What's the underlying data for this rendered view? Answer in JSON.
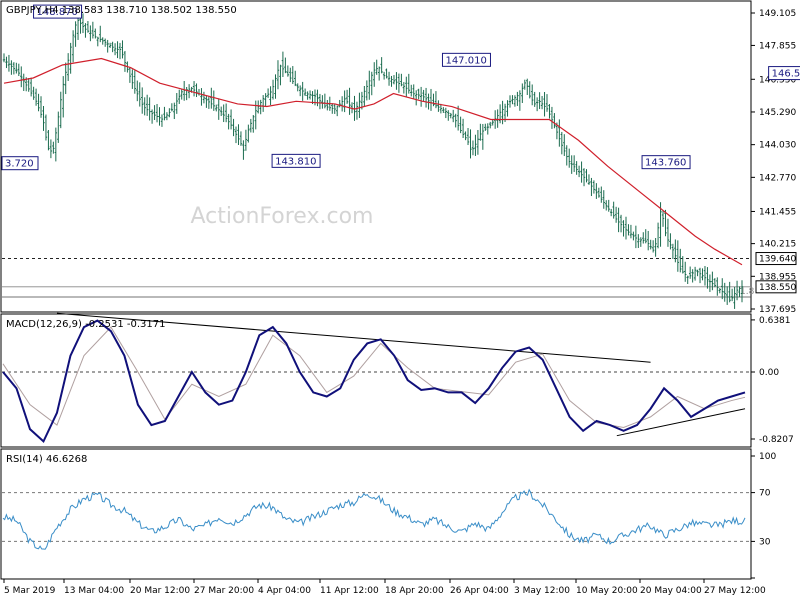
{
  "watermark": "ActionForex.com",
  "price_pane": {
    "header": "GBPJPY,H4  138.583 138.710 138.502 138.550",
    "y_ticks": [
      "149.105",
      "147.855",
      "146.550",
      "145.290",
      "144.030",
      "142.770",
      "141.455",
      "140.215",
      "138.955",
      "137.695"
    ],
    "current_price_label": "138.550",
    "level_line_label": "139.640",
    "cut_label": "1.8"
  },
  "macd_pane": {
    "header": "MACD(12,26,9) -0.2531 -0.3171",
    "y_ticks": [
      "0.6381",
      "0.00",
      "-0.8207"
    ]
  },
  "rsi_pane": {
    "header": "RSI(14) 46.6268",
    "y_ticks": [
      "100",
      "70",
      "30",
      "0"
    ]
  },
  "x_ticks": [
    "5 Mar 2019",
    "13 Mar 04:00",
    "20 Mar 12:00",
    "27 Mar 20:00",
    "4 Apr 04:00",
    "11 Apr 12:00",
    "18 Apr 20:00",
    "26 Apr 04:00",
    "3 May 12:00",
    "10 May 20:00",
    "20 May 04:00",
    "27 May 12:00"
  ],
  "colors": {
    "candle": "#1a6b4e",
    "ma": "#d0202c",
    "macd": "#10107a",
    "signal": "#b0a0a0",
    "rsi": "#3a8ec8",
    "label_border": "#1a1a80"
  },
  "chart_data": [
    {
      "type": "candlestick",
      "title": "GBPJPY,H4",
      "ylim": [
        137.4,
        149.4
      ],
      "swing_labels": [
        {
          "text": "148.870",
          "x": 5.5,
          "value": 148.87
        },
        {
          "text": "3.720",
          "x": 0.5,
          "value": 143.72
        },
        {
          "text": "143.810",
          "x": 30,
          "value": 143.81
        },
        {
          "text": "147.010",
          "x": 47.5,
          "value": 147.01
        },
        {
          "text": "143.760",
          "x": 68,
          "value": 143.76
        },
        {
          "text": "146.500",
          "x": 81,
          "value": 146.5
        }
      ],
      "horizontal_levels": [
        139.64,
        138.55
      ],
      "series": [
        {
          "name": "GBPJPY",
          "values": [
            [
              0,
              147.3
            ],
            [
              1.5,
              146.8
            ],
            [
              2.5,
              146.2
            ],
            [
              3.3,
              145.7
            ],
            [
              4,
              145.0
            ],
            [
              4.5,
              143.9
            ],
            [
              5,
              143.72
            ],
            [
              5.5,
              144.9
            ],
            [
              6,
              146.2
            ],
            [
              6.6,
              147.3
            ],
            [
              7,
              148.1
            ],
            [
              7.5,
              148.87
            ],
            [
              8.3,
              148.5
            ],
            [
              9.3,
              148.2
            ],
            [
              10.3,
              148.0
            ],
            [
              11.5,
              147.7
            ],
            [
              12,
              147.7
            ],
            [
              12.5,
              147.1
            ],
            [
              13.3,
              146.3
            ],
            [
              14.3,
              145.5
            ],
            [
              15.3,
              145.2
            ],
            [
              16.3,
              145.0
            ],
            [
              17.3,
              145.4
            ],
            [
              18.3,
              146.1
            ],
            [
              19.3,
              146.2
            ],
            [
              20.3,
              145.9
            ],
            [
              21.3,
              145.6
            ],
            [
              22.3,
              145.3
            ],
            [
              23.3,
              144.8
            ],
            [
              24.3,
              144.1
            ],
            [
              24.6,
              143.81
            ],
            [
              25,
              144.5
            ],
            [
              25.8,
              145.3
            ],
            [
              26.6,
              145.8
            ],
            [
              27.5,
              146.1
            ],
            [
              28.3,
              147.1
            ],
            [
              29,
              146.8
            ],
            [
              30,
              146.3
            ],
            [
              31,
              146.0
            ],
            [
              32,
              145.9
            ],
            [
              33,
              145.5
            ],
            [
              34,
              145.4
            ],
            [
              35,
              145.8
            ],
            [
              36,
              145.3
            ],
            [
              36.5,
              145.7
            ],
            [
              37.3,
              146.3
            ],
            [
              38,
              146.9
            ],
            [
              38.5,
              147.01
            ],
            [
              39,
              146.7
            ],
            [
              40,
              146.5
            ],
            [
              41,
              146.3
            ],
            [
              42,
              146.0
            ],
            [
              43,
              145.9
            ],
            [
              44,
              145.6
            ],
            [
              45,
              145.4
            ],
            [
              46.2,
              145.1
            ],
            [
              47,
              144.5
            ],
            [
              47.6,
              144.2
            ],
            [
              48,
              143.76
            ],
            [
              48.5,
              144.1
            ],
            [
              49,
              144.5
            ],
            [
              50,
              144.8
            ],
            [
              51,
              145.3
            ],
            [
              52,
              145.7
            ],
            [
              53,
              146.0
            ],
            [
              53.6,
              146.5
            ],
            [
              54,
              145.9
            ],
            [
              54.5,
              145.6
            ],
            [
              55,
              145.7
            ],
            [
              55.8,
              145.4
            ],
            [
              56.5,
              144.8
            ],
            [
              57.3,
              144.0
            ],
            [
              58,
              143.4
            ],
            [
              59,
              143.0
            ],
            [
              60,
              142.6
            ],
            [
              61,
              142.1
            ],
            [
              62,
              141.6
            ],
            [
              63,
              141.1
            ],
            [
              64,
              140.7
            ],
            [
              65,
              140.4
            ],
            [
              66,
              140.3
            ],
            [
              66.8,
              139.9
            ],
            [
              67.5,
              141.6
            ],
            [
              68,
              140.5
            ],
            [
              68.8,
              139.9
            ],
            [
              69.5,
              139.2
            ],
            [
              70.3,
              138.9
            ],
            [
              71,
              139.2
            ],
            [
              72,
              138.9
            ],
            [
              73,
              138.6
            ],
            [
              74,
              138.3
            ],
            [
              74.6,
              138.0
            ],
            [
              75.2,
              138.4
            ],
            [
              75.8,
              138.55
            ]
          ]
        },
        {
          "name": "MA",
          "values": [
            [
              0,
              146.4
            ],
            [
              3,
              146.6
            ],
            [
              6,
              147.1
            ],
            [
              10,
              147.35
            ],
            [
              13,
              147.0
            ],
            [
              16,
              146.4
            ],
            [
              20,
              146.0
            ],
            [
              24,
              145.6
            ],
            [
              27,
              145.5
            ],
            [
              30,
              145.7
            ],
            [
              34,
              145.6
            ],
            [
              36,
              145.4
            ],
            [
              38,
              145.6
            ],
            [
              40,
              146.0
            ],
            [
              43,
              145.7
            ],
            [
              46,
              145.5
            ],
            [
              50,
              145.0
            ],
            [
              53,
              145.0
            ],
            [
              56,
              145.0
            ],
            [
              59,
              144.2
            ],
            [
              62,
              143.2
            ],
            [
              65,
              142.3
            ],
            [
              68,
              141.4
            ],
            [
              71,
              140.5
            ],
            [
              73,
              140.0
            ],
            [
              75.8,
              139.4
            ]
          ]
        }
      ]
    },
    {
      "type": "line",
      "title": "MACD(12,26,9)",
      "ylim": [
        -0.95,
        0.75
      ],
      "series": [
        {
          "name": "MACD",
          "values": [
            [
              0,
              0.0
            ],
            [
              1,
              -0.2
            ],
            [
              2,
              -0.7
            ],
            [
              3,
              -0.85
            ],
            [
              4,
              -0.5
            ],
            [
              5,
              0.2
            ],
            [
              6,
              0.55
            ],
            [
              7,
              0.63
            ],
            [
              8,
              0.5
            ],
            [
              9,
              0.2
            ],
            [
              10,
              -0.4
            ],
            [
              11,
              -0.65
            ],
            [
              12,
              -0.6
            ],
            [
              13,
              -0.3
            ],
            [
              14,
              0.0
            ],
            [
              15,
              -0.25
            ],
            [
              16,
              -0.4
            ],
            [
              17,
              -0.35
            ],
            [
              18,
              0.0
            ],
            [
              19,
              0.45
            ],
            [
              20,
              0.55
            ],
            [
              21,
              0.35
            ],
            [
              22,
              0.0
            ],
            [
              23,
              -0.25
            ],
            [
              24,
              -0.3
            ],
            [
              25,
              -0.2
            ],
            [
              26,
              0.15
            ],
            [
              27,
              0.35
            ],
            [
              28,
              0.4
            ],
            [
              29,
              0.2
            ],
            [
              30,
              -0.1
            ],
            [
              31,
              -0.22
            ],
            [
              32,
              -0.2
            ],
            [
              33,
              -0.25
            ],
            [
              34,
              -0.25
            ],
            [
              35,
              -0.38
            ],
            [
              36,
              -0.2
            ],
            [
              37,
              0.05
            ],
            [
              38,
              0.25
            ],
            [
              39,
              0.3
            ],
            [
              40,
              0.15
            ],
            [
              41,
              -0.2
            ],
            [
              42,
              -0.55
            ],
            [
              43,
              -0.72
            ],
            [
              44,
              -0.6
            ],
            [
              45,
              -0.65
            ],
            [
              46,
              -0.72
            ],
            [
              47,
              -0.65
            ],
            [
              48,
              -0.45
            ],
            [
              49,
              -0.2
            ],
            [
              50,
              -0.35
            ],
            [
              51,
              -0.55
            ],
            [
              52,
              -0.45
            ],
            [
              53,
              -0.35
            ],
            [
              54,
              -0.3
            ],
            [
              55,
              -0.25
            ]
          ]
        },
        {
          "name": "Signal",
          "values": [
            [
              0,
              0.1
            ],
            [
              2,
              -0.4
            ],
            [
              4,
              -0.65
            ],
            [
              6,
              0.2
            ],
            [
              8,
              0.55
            ],
            [
              10,
              0.0
            ],
            [
              12,
              -0.58
            ],
            [
              14,
              -0.15
            ],
            [
              16,
              -0.3
            ],
            [
              18,
              -0.15
            ],
            [
              20,
              0.45
            ],
            [
              22,
              0.2
            ],
            [
              24,
              -0.25
            ],
            [
              26,
              -0.05
            ],
            [
              28,
              0.35
            ],
            [
              30,
              0.05
            ],
            [
              32,
              -0.2
            ],
            [
              34,
              -0.24
            ],
            [
              36,
              -0.28
            ],
            [
              38,
              0.12
            ],
            [
              40,
              0.22
            ],
            [
              42,
              -0.35
            ],
            [
              44,
              -0.62
            ],
            [
              46,
              -0.68
            ],
            [
              48,
              -0.55
            ],
            [
              50,
              -0.3
            ],
            [
              52,
              -0.45
            ],
            [
              54,
              -0.35
            ],
            [
              55,
              -0.31
            ]
          ]
        }
      ]
    },
    {
      "type": "line",
      "title": "RSI(14)",
      "ylim": [
        0,
        100
      ],
      "series": [
        {
          "name": "RSI",
          "values": [
            [
              0,
              50
            ],
            [
              1,
              47
            ],
            [
              2,
              30
            ],
            [
              3,
              22
            ],
            [
              4,
              42
            ],
            [
              5,
              56
            ],
            [
              6,
              65
            ],
            [
              7,
              68
            ],
            [
              8,
              60
            ],
            [
              9,
              55
            ],
            [
              10,
              45
            ],
            [
              11,
              38
            ],
            [
              12,
              42
            ],
            [
              13,
              48
            ],
            [
              14,
              40
            ],
            [
              15,
              43
            ],
            [
              16,
              50
            ],
            [
              17,
              45
            ],
            [
              18,
              52
            ],
            [
              19,
              60
            ],
            [
              20,
              58
            ],
            [
              21,
              48
            ],
            [
              22,
              45
            ],
            [
              23,
              50
            ],
            [
              24,
              55
            ],
            [
              25,
              60
            ],
            [
              26,
              62
            ],
            [
              27,
              70
            ],
            [
              28,
              64
            ],
            [
              29,
              55
            ],
            [
              30,
              50
            ],
            [
              31,
              44
            ],
            [
              32,
              48
            ],
            [
              33,
              42
            ],
            [
              34,
              38
            ],
            [
              35,
              45
            ],
            [
              36,
              40
            ],
            [
              37,
              54
            ],
            [
              38,
              66
            ],
            [
              39,
              70
            ],
            [
              40,
              60
            ],
            [
              41,
              48
            ],
            [
              42,
              35
            ],
            [
              43,
              30
            ],
            [
              44,
              35
            ],
            [
              45,
              30
            ],
            [
              46,
              35
            ],
            [
              47,
              40
            ],
            [
              48,
              43
            ],
            [
              49,
              35
            ],
            [
              50,
              40
            ],
            [
              51,
              45
            ],
            [
              52,
              44
            ],
            [
              53,
              43
            ],
            [
              54,
              47
            ],
            [
              55,
              46.6
            ]
          ]
        }
      ]
    }
  ]
}
